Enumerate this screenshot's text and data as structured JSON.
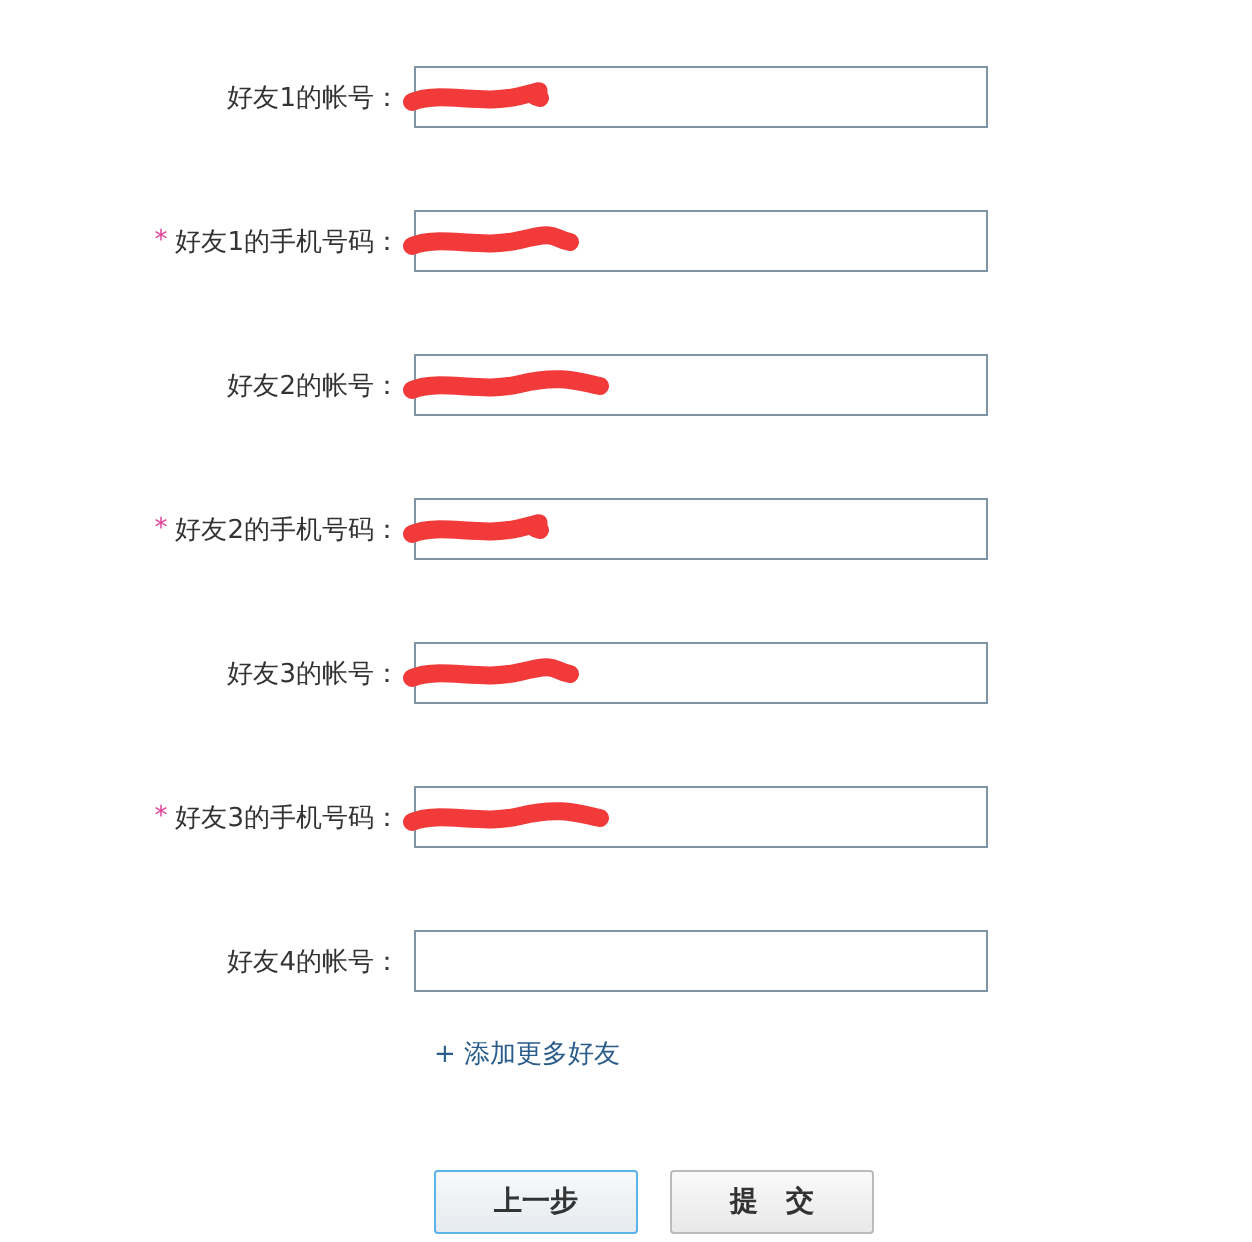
{
  "fields": [
    {
      "label": "好友1的帐号：",
      "required": false,
      "redacted": true
    },
    {
      "label": "好友1的手机号码：",
      "required": true,
      "redacted": true
    },
    {
      "label": "好友2的帐号：",
      "required": false,
      "redacted": true
    },
    {
      "label": "好友2的手机号码：",
      "required": true,
      "redacted": true
    },
    {
      "label": "好友3的帐号：",
      "required": false,
      "redacted": true
    },
    {
      "label": "好友3的手机号码：",
      "required": true,
      "redacted": true
    },
    {
      "label": "好友4的帐号：",
      "required": false,
      "redacted": false
    }
  ],
  "required_mark": "*",
  "add_link": "+ 添加更多好友",
  "buttons": [
    {
      "label": "上一步",
      "focused": true
    },
    {
      "label": "提　交",
      "focused": false
    }
  ]
}
